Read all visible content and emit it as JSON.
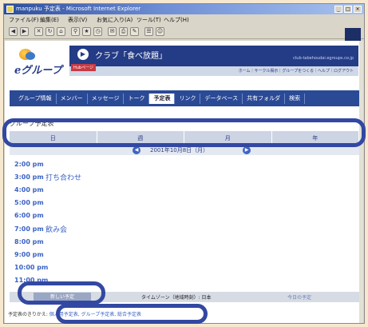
{
  "window": {
    "title": "manpuku 予定表 - Microsoft Internet Explorer"
  },
  "menubar": [
    "ファイル(F)",
    "編集(E)",
    "表示(V)",
    "お気に入り(A)",
    "ツール(T)",
    "ヘルプ(H)"
  ],
  "logo": {
    "text": "eグループ"
  },
  "banner": {
    "title": "クラブ「食べ放題」",
    "tag": "Hubページ",
    "url": "club-tabehoudai.egroups.co.jp",
    "links": "ホーム｜サークル掲示｜グループをつくる｜ヘルプ｜ログアウト"
  },
  "nav": {
    "tabs": [
      "グループ情報",
      "メンバー",
      "メッセージ",
      "トーク",
      "予定表",
      "リンク",
      "データベース",
      "共有フォルダ",
      "検索"
    ],
    "active_index": 4
  },
  "heading": "グループ予定表",
  "view_tabs": [
    "日",
    "週",
    "月",
    "年"
  ],
  "date_label": "2001年10月8日（月）",
  "schedule": [
    {
      "time": "2:00 pm",
      "event": ""
    },
    {
      "time": "3:00 pm",
      "event": "打ち合わせ"
    },
    {
      "time": "4:00 pm",
      "event": ""
    },
    {
      "time": "5:00 pm",
      "event": ""
    },
    {
      "time": "6:00 pm",
      "event": ""
    },
    {
      "time": "7:00 pm",
      "event": "飲み会"
    },
    {
      "time": "8:00 pm",
      "event": ""
    },
    {
      "time": "9:00 pm",
      "event": ""
    },
    {
      "time": "10:00 pm",
      "event": ""
    },
    {
      "time": "11:00 pm",
      "event": ""
    }
  ],
  "footer": {
    "new_button": "新しい予定",
    "timezone": "タイムゾーン（地域時刻）: 日本",
    "today": "今日の予定"
  },
  "view_links": {
    "prefix": "予定表のきりかえ:",
    "links": "個人用予定表, グループ予定表, 総合予定表"
  },
  "colors": {
    "nav_bg": "#2b4a96",
    "highlight": "#3348a2",
    "time_text": "#3a62c4"
  }
}
